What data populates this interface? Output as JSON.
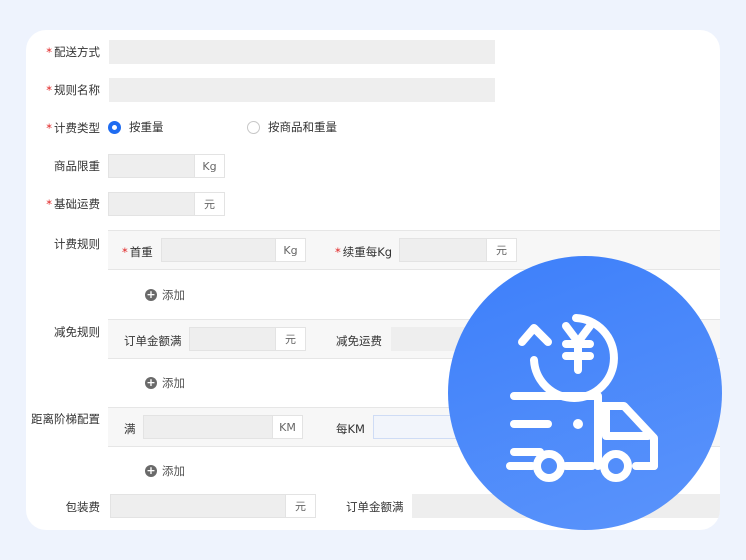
{
  "form": {
    "delivery_method": {
      "label": "配送方式",
      "required": true,
      "value": ""
    },
    "rule_name": {
      "label": "规则名称",
      "required": true,
      "value": ""
    },
    "billing_type": {
      "label": "计费类型",
      "required": true,
      "options": [
        {
          "label": "按重量",
          "selected": true
        },
        {
          "label": "按商品和重量",
          "selected": false
        }
      ]
    },
    "weight_limit": {
      "label": "商品限重",
      "required": false,
      "value": "",
      "unit": "Kg"
    },
    "base_freight": {
      "label": "基础运费",
      "required": true,
      "value": "",
      "unit": "元"
    },
    "billing_rules": {
      "label": "计费规则",
      "first_weight": {
        "label": "首重",
        "required": true,
        "value": "",
        "unit": "Kg"
      },
      "extra_per_kg": {
        "label": "续重每Kg",
        "required": true,
        "value": "",
        "unit": "元"
      },
      "add_label": "添加"
    },
    "discount_rules": {
      "label": "减免规则",
      "order_amount": {
        "label": "订单金额满",
        "value": "",
        "unit": "元"
      },
      "waive_freight": {
        "label": "减免运费",
        "value": ""
      },
      "add_label": "添加"
    },
    "distance_tiers": {
      "label": "距离阶梯配置",
      "full": {
        "label": "满",
        "value": "",
        "unit": "KM"
      },
      "per_km": {
        "label": "每KM",
        "value": ""
      },
      "add_label": "添加"
    },
    "packaging_fee": {
      "label": "包装费",
      "value": "",
      "unit": "元"
    },
    "packaging_order_amount": {
      "label": "订单金额满",
      "value": ""
    }
  },
  "badge": {
    "icon": "delivery-truck-yuan-refund-icon",
    "color": "#3d7ffa"
  },
  "colors": {
    "accent": "#1f6cf1",
    "required": "#e02020",
    "background": "#eef3fd"
  }
}
